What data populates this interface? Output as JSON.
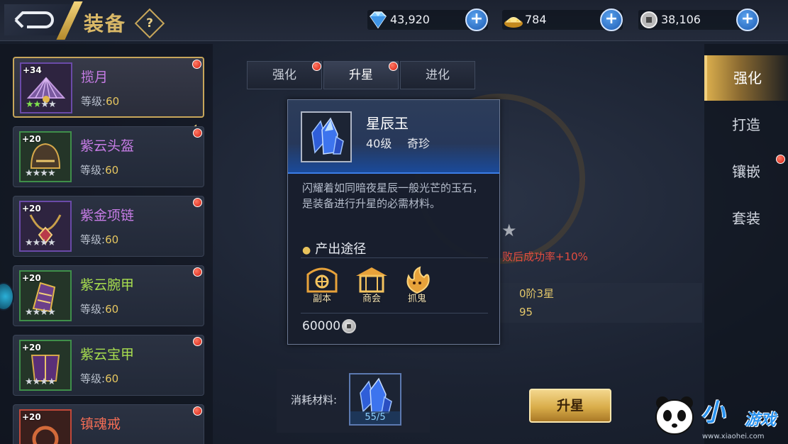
{
  "header": {
    "title": "装备",
    "help_symbol": "?",
    "currencies": [
      {
        "icon": "diamond-icon",
        "value": "43,920",
        "plus": "+"
      },
      {
        "icon": "gold-ingot-icon",
        "value": "784",
        "plus": "+"
      },
      {
        "icon": "silver-coin-icon",
        "value": "38,106",
        "plus": "+"
      }
    ]
  },
  "equipment_list": [
    {
      "level": "+34",
      "name": "揽月",
      "lv_label": "等级:",
      "lv": "60",
      "stars_lit": 2,
      "stars_total": 4,
      "selected": true
    },
    {
      "level": "+20",
      "name": "紫云头盔",
      "lv_label": "等级:",
      "lv": "60",
      "stars_lit": 0,
      "stars_total": 4
    },
    {
      "level": "+20",
      "name": "紫金项链",
      "lv_label": "等级:",
      "lv": "60",
      "stars_lit": 0,
      "stars_total": 4
    },
    {
      "level": "+20",
      "name": "紫云腕甲",
      "lv_label": "等级:",
      "lv": "60",
      "stars_lit": 0,
      "stars_total": 4
    },
    {
      "level": "+20",
      "name": "紫云宝甲",
      "lv_label": "等级:",
      "lv": "60",
      "stars_lit": 0,
      "stars_total": 4
    },
    {
      "level": "+20",
      "name": "镇魂戒",
      "lv_label": "",
      "lv": "",
      "stars_lit": 0,
      "stars_total": 0
    }
  ],
  "tabs": [
    {
      "label": "强化"
    },
    {
      "label": "升星"
    },
    {
      "label": "进化"
    }
  ],
  "background_info": {
    "fail_text": "败后成功率+10%",
    "stat1": "0阶3星",
    "stat2": "95"
  },
  "tooltip": {
    "name": "星辰玉",
    "level": "40级",
    "rarity": "奇珍",
    "description": "闪耀着如同暗夜星辰一般光芒的玉石，是装备进行升星的必需材料。",
    "source_title": "产出途径",
    "sources": [
      {
        "label": "副本",
        "icon": "dungeon-gate-icon"
      },
      {
        "label": "商会",
        "icon": "shop-pavilion-icon"
      },
      {
        "label": "抓鬼",
        "icon": "ghost-fire-icon"
      }
    ],
    "price": "60000"
  },
  "material": {
    "label": "消耗材料:",
    "count": "55/5"
  },
  "upgrade_button": "升星",
  "right_nav": [
    {
      "label": "强化",
      "active": true,
      "dot": false
    },
    {
      "label": "打造",
      "active": false,
      "dot": false
    },
    {
      "label": "镶嵌",
      "active": false,
      "dot": true
    },
    {
      "label": "套装",
      "active": false,
      "dot": false
    }
  ],
  "watermark": {
    "small": "小",
    "big": "游戏",
    "url": "www.xiaohei.com"
  },
  "colors": {
    "gold": "#d9b867",
    "purple_name": "#c77de6",
    "green_name": "#a7dd4f",
    "red_name": "#f36d55",
    "fail_red": "#e24c3f"
  }
}
